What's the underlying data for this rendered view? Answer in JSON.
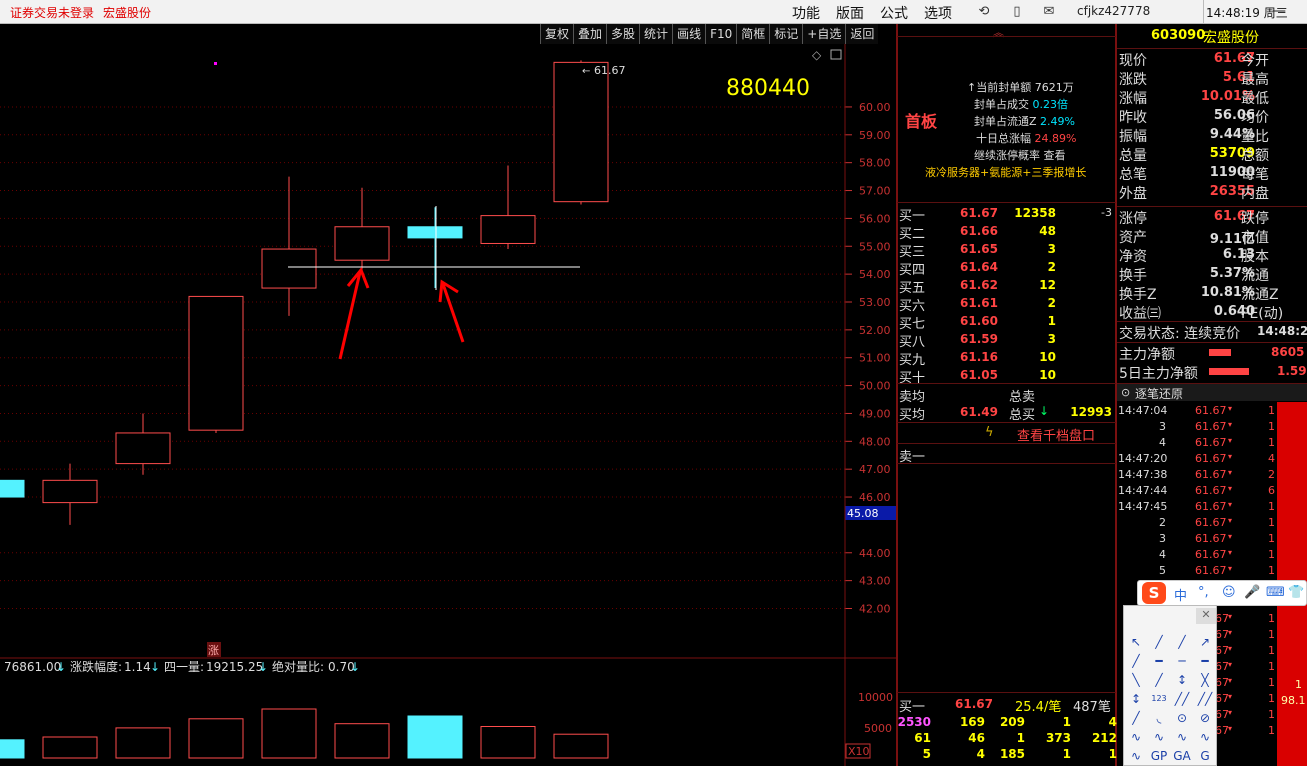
{
  "topbar": {
    "status": "证券交易未登录",
    "stock_name": "宏盛股份",
    "menus": [
      "功能",
      "版面",
      "公式",
      "选项"
    ],
    "user": "cfjkz427778",
    "clock": "14:48:19 周三"
  },
  "toolbar": {
    "items": [
      "复权",
      "叠加",
      "多股",
      "统计",
      "画线",
      "F10",
      "简框",
      "标记",
      "+自选",
      "返回"
    ]
  },
  "chart": {
    "index_code": "880440",
    "high_label": "61.67",
    "highlight_price": "45.08",
    "badge": "涨",
    "indicator": {
      "v1": "76861.00",
      "label2": "涨跌幅度:",
      "v2": "1.14",
      "label3": "四一量:",
      "v3": "19215.25",
      "label4": "绝对量比:",
      "v4": "0.70"
    },
    "volume_axis": [
      "10000",
      "5000"
    ],
    "volume_unit": "X10",
    "colors": {
      "up": "#ff4d4d",
      "down": "#54f2ff",
      "grid": "#6a0000",
      "axis_text": "#c83232"
    }
  },
  "chart_data": {
    "type": "candlestick",
    "y_ticks": [
      60.0,
      59.0,
      58.0,
      57.0,
      56.0,
      55.0,
      54.0,
      53.0,
      52.0,
      51.0,
      50.0,
      49.0,
      48.0,
      47.0,
      46.0,
      44.0,
      43.0,
      42.0
    ],
    "ylim": [
      41.3,
      61.9
    ],
    "candles": [
      {
        "o": 46.6,
        "c": 46.0,
        "h": 46.6,
        "l": 46.0,
        "dir": "down",
        "vol": 2600,
        "vdir": "down"
      },
      {
        "o": 45.8,
        "c": 46.6,
        "h": 47.2,
        "l": 45.0,
        "dir": "up",
        "vol": 3000,
        "vdir": "up"
      },
      {
        "o": 47.2,
        "c": 48.3,
        "h": 49.0,
        "l": 46.8,
        "dir": "up",
        "vol": 4300,
        "vdir": "up"
      },
      {
        "o": 48.4,
        "c": 53.2,
        "h": 53.2,
        "l": 48.3,
        "dir": "up",
        "vol": 5600,
        "vdir": "up"
      },
      {
        "o": 53.5,
        "c": 54.9,
        "h": 57.5,
        "l": 52.5,
        "dir": "up",
        "vol": 7000,
        "vdir": "up"
      },
      {
        "o": 54.5,
        "c": 55.7,
        "h": 57.1,
        "l": 54.1,
        "dir": "up",
        "vol": 4900,
        "vdir": "up"
      },
      {
        "o": 55.7,
        "c": 55.3,
        "h": 56.4,
        "l": 53.5,
        "dir": "down",
        "vol": 6000,
        "vdir": "down"
      },
      {
        "o": 55.1,
        "c": 56.1,
        "h": 57.9,
        "l": 54.9,
        "dir": "up",
        "vol": 4500,
        "vdir": "up"
      },
      {
        "o": 56.6,
        "c": 61.6,
        "h": 61.67,
        "l": 56.5,
        "dir": "up",
        "vol": 3400,
        "vdir": "up"
      }
    ],
    "volume_max": 10000
  },
  "midpanel": {
    "collapse_glyph": "︽",
    "title": "首板",
    "lines": [
      {
        "label": "↑当前封单额",
        "value": "7621万"
      },
      {
        "label": "封单占成交",
        "value": "0.23倍"
      },
      {
        "label": "封单占流通Z",
        "value": "2.49%"
      },
      {
        "label": "十日总涨幅",
        "value": "24.89%"
      },
      {
        "label": "继续涨停概率",
        "value": "查看"
      }
    ],
    "concept": "液冷服务器+氨能源+三季报增长",
    "orderbook": [
      {
        "label": "买一",
        "price": "61.67",
        "vol": "12358",
        "chg": "-3"
      },
      {
        "label": "买二",
        "price": "61.66",
        "vol": "48",
        "chg": ""
      },
      {
        "label": "买三",
        "price": "61.65",
        "vol": "3",
        "chg": ""
      },
      {
        "label": "买四",
        "price": "61.64",
        "vol": "2",
        "chg": ""
      },
      {
        "label": "买五",
        "price": "61.62",
        "vol": "12",
        "chg": ""
      },
      {
        "label": "买六",
        "price": "61.61",
        "vol": "2",
        "chg": ""
      },
      {
        "label": "买七",
        "price": "61.60",
        "vol": "1",
        "chg": ""
      },
      {
        "label": "买八",
        "price": "61.59",
        "vol": "3",
        "chg": ""
      },
      {
        "label": "买九",
        "price": "61.16",
        "vol": "10",
        "chg": ""
      },
      {
        "label": "买十",
        "price": "61.05",
        "vol": "10",
        "chg": ""
      }
    ],
    "sell_avg_label": "卖均",
    "total_sell_label": "总卖",
    "buy_avg_label": "买均",
    "buy_avg": "61.49",
    "total_buy_label": "总买",
    "total_buy": "12993",
    "depth_link": "查看千档盘口",
    "sell1_label": "卖一",
    "bottom": {
      "label": "买一",
      "price": "61.67",
      "avg": "25.4/笔",
      "count": "487笔",
      "rows": [
        [
          "2530",
          "169",
          "209",
          "1",
          "4"
        ],
        [
          "61",
          "46",
          "1",
          "373",
          "212"
        ],
        [
          "5",
          "4",
          "185",
          "1",
          "1"
        ]
      ]
    }
  },
  "quote": {
    "code": "603090",
    "name": "宏盛股份",
    "rows": [
      {
        "l1": "现价",
        "v1": "61.67",
        "c": "#ff4444",
        "l2": "今开"
      },
      {
        "l1": "涨跌",
        "v1": "5.61",
        "c": "#ff4444",
        "l2": "最高"
      },
      {
        "l1": "涨幅",
        "v1": "10.01%",
        "c": "#ff4444",
        "l2": "最低"
      },
      {
        "l1": "昨收",
        "v1": "56.06",
        "c": "#dddddd",
        "l2": "均价"
      },
      {
        "l1": "振幅",
        "v1": "9.44%",
        "c": "#dddddd",
        "l2": "量比"
      },
      {
        "l1": "总量",
        "v1": "53709",
        "c": "#ffff00",
        "l2": "总额"
      },
      {
        "l1": "总笔",
        "v1": "11900",
        "c": "#dddddd",
        "l2": "每笔"
      },
      {
        "l1": "外盘",
        "v1": "26355",
        "c": "#ff4444",
        "l2": "内盘"
      },
      {
        "l1": "涨停",
        "v1": "61.67",
        "c": "#ff4444",
        "l2": "跌停"
      },
      {
        "l1": "资产",
        "v1": "9.11亿",
        "c": "#dddddd",
        "l2": "市值"
      },
      {
        "l1": "净资",
        "v1": "6.13",
        "c": "#dddddd",
        "l2": "股本"
      },
      {
        "l1": "换手",
        "v1": "5.37%",
        "c": "#dddddd",
        "l2": "流通"
      },
      {
        "l1": "换手Z",
        "v1": "10.81%",
        "c": "#dddddd",
        "l2": "流通Z"
      },
      {
        "l1": "收益㈢",
        "v1": "0.640",
        "c": "#dddddd",
        "l2": "PE(动)"
      }
    ],
    "trade_state": "交易状态: 连续竞价",
    "trade_time": "14:48:2",
    "main_net": {
      "label": "主力净额",
      "value": "8605"
    },
    "main_net5": {
      "label": "5日主力净额",
      "value": "1.59"
    },
    "tick_title": "逐笔还原",
    "ticks": [
      {
        "t": "14:47:04",
        "p": "61.67",
        "v": "1",
        "s": "S"
      },
      {
        "t": "3",
        "p": "61.67",
        "v": "1",
        "s": "S"
      },
      {
        "t": "4",
        "p": "61.67",
        "v": "1",
        "s": "S"
      },
      {
        "t": "14:47:20",
        "p": "61.67",
        "v": "4",
        "s": "S"
      },
      {
        "t": "14:47:38",
        "p": "61.67",
        "v": "2",
        "s": "S"
      },
      {
        "t": "14:47:44",
        "p": "61.67",
        "v": "6",
        "s": "S"
      },
      {
        "t": "14:47:45",
        "p": "61.67",
        "v": "1",
        "s": "S"
      },
      {
        "t": "2",
        "p": "61.67",
        "v": "1",
        "s": "S"
      },
      {
        "t": "3",
        "p": "61.67",
        "v": "1",
        "s": "S"
      },
      {
        "t": "4",
        "p": "61.67",
        "v": "1",
        "s": "S"
      },
      {
        "t": "5",
        "p": "61.67",
        "v": "1",
        "s": "S"
      },
      {
        "t": "",
        "p": "67",
        "v": "1",
        "s": "S"
      },
      {
        "t": "",
        "p": "67",
        "v": "1",
        "s": "S"
      },
      {
        "t": "",
        "p": "67",
        "v": "1",
        "s": "S"
      },
      {
        "t": "",
        "p": "67",
        "v": "1",
        "s": "S"
      },
      {
        "t": "",
        "p": "67",
        "v": "1",
        "s": "S"
      },
      {
        "t": "",
        "p": "67",
        "v": "1",
        "s": "S"
      },
      {
        "t": "",
        "p": "67",
        "v": "1",
        "s": "S"
      },
      {
        "t": "",
        "p": "67",
        "v": "1",
        "s": "S"
      },
      {
        "t": "",
        "p": "67",
        "v": "1",
        "s": "S"
      },
      {
        "t": "",
        "p": "67",
        "v": "1",
        "s": "S"
      }
    ],
    "side_red_1": "1",
    "side_red_2": "98.1"
  },
  "ime": {
    "items": [
      "中",
      "°,",
      "☺",
      "🎤",
      "⌨",
      "👕"
    ],
    "tool_glyphs": [
      "↖",
      "╱",
      "╱",
      "↗",
      "╱",
      "━",
      "─",
      "━",
      "╲",
      "╱",
      "↕",
      "╳",
      "↕",
      "123",
      "╱╱",
      "╱╱",
      "╱",
      "◟",
      "⊙",
      "⊘",
      "∿",
      "∿",
      "∿",
      "∿",
      "∿",
      "GP",
      "GA",
      "G"
    ]
  }
}
